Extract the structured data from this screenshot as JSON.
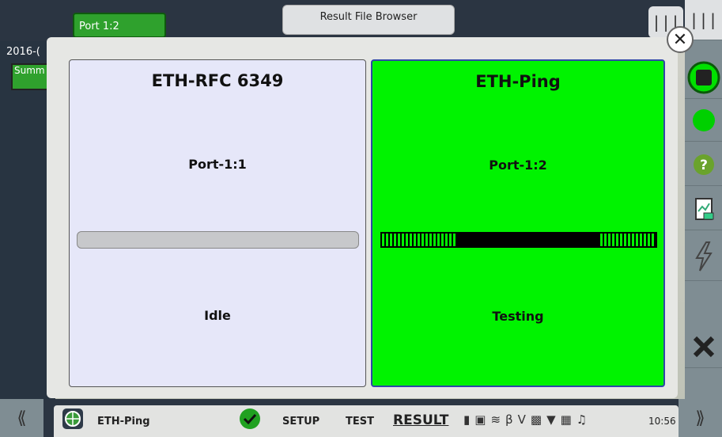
{
  "background": {
    "port_tab": "Port 1:2",
    "result_file_browser": "Result File Browser",
    "date_partial": "2016-(",
    "summary_partial": "Summ"
  },
  "modal": {
    "cards": [
      {
        "title": "ETH-RFC 6349",
        "port": "Port-1:1",
        "state": "Idle",
        "progress": 0,
        "bg_color": "#e6e7f9"
      },
      {
        "title": "ETH-Ping",
        "port": "Port-1:2",
        "state": "Testing",
        "progress": "indeterminate",
        "bg_color": "#00f300"
      }
    ]
  },
  "right_toolbar": [
    "stop-icon",
    "status-dot-icon",
    "help-icon",
    "report-icon",
    "lightning-icon",
    "close-icon"
  ],
  "bottom": {
    "app_name": "ETH-Ping",
    "setup": "SETUP",
    "test": "TEST",
    "result": "RESULT",
    "time": "10:56"
  }
}
